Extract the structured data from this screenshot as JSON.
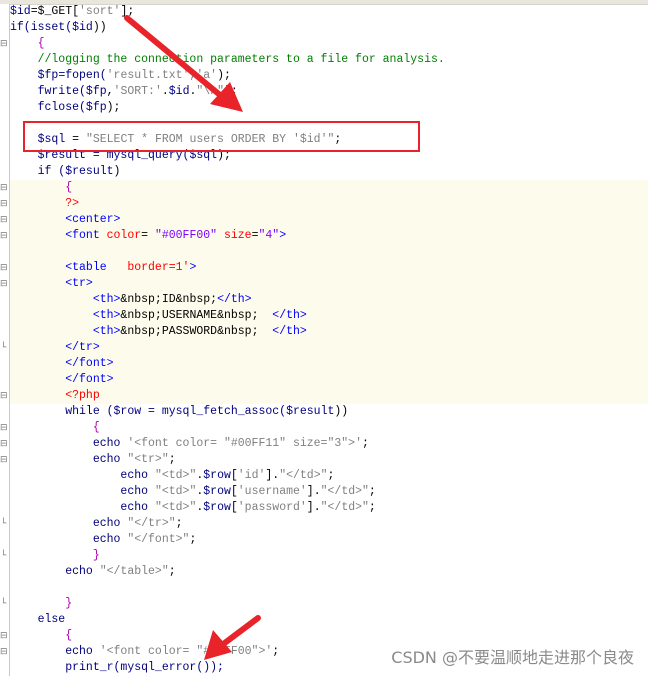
{
  "editor": {
    "lines": [
      [
        {
          "t": "$id",
          "c": "var"
        },
        {
          "t": "=$_GET[",
          "c": "plain"
        },
        {
          "t": "'sort'",
          "c": "str"
        },
        {
          "t": "];",
          "c": "plain"
        }
      ],
      [
        {
          "t": "if(isset(",
          "c": "kw"
        },
        {
          "t": "$id",
          "c": "var"
        },
        {
          "t": "))",
          "c": "plain"
        }
      ],
      [
        {
          "t": "    {",
          "c": "brace"
        }
      ],
      [
        {
          "t": "    //logging the connection parameters to a file for analysis.",
          "c": "com"
        }
      ],
      [
        {
          "t": "    ",
          "c": "plain"
        },
        {
          "t": "$fp",
          "c": "var"
        },
        {
          "t": "=fopen(",
          "c": "fn"
        },
        {
          "t": "'result.txt','a'",
          "c": "str"
        },
        {
          "t": ");",
          "c": "plain"
        }
      ],
      [
        {
          "t": "    fwrite(",
          "c": "fn"
        },
        {
          "t": "$fp",
          "c": "var"
        },
        {
          "t": ",",
          "c": "plain"
        },
        {
          "t": "'SORT:'",
          "c": "str"
        },
        {
          "t": ".",
          "c": "plain"
        },
        {
          "t": "$id",
          "c": "var"
        },
        {
          "t": ".",
          "c": "plain"
        },
        {
          "t": "\"\\n\"",
          "c": "str"
        },
        {
          "t": ");",
          "c": "plain"
        }
      ],
      [
        {
          "t": "    fclose(",
          "c": "fn"
        },
        {
          "t": "$fp",
          "c": "var"
        },
        {
          "t": ");",
          "c": "plain"
        }
      ],
      [
        {
          "t": "",
          "c": "plain"
        }
      ],
      [
        {
          "t": "    ",
          "c": "plain"
        },
        {
          "t": "$sql",
          "c": "var"
        },
        {
          "t": " = ",
          "c": "plain"
        },
        {
          "t": "\"SELECT * FROM users ORDER BY '$id'\"",
          "c": "str"
        },
        {
          "t": ";",
          "c": "plain"
        }
      ],
      [
        {
          "t": "    ",
          "c": "plain"
        },
        {
          "t": "$result",
          "c": "var"
        },
        {
          "t": " = mysql_query(",
          "c": "fn"
        },
        {
          "t": "$sql",
          "c": "var"
        },
        {
          "t": ");",
          "c": "plain"
        }
      ],
      [
        {
          "t": "    if (",
          "c": "kw"
        },
        {
          "t": "$result",
          "c": "var"
        },
        {
          "t": ")",
          "c": "plain"
        }
      ],
      [
        {
          "t": "        {",
          "c": "brace"
        }
      ],
      [
        {
          "t": "        ?>",
          "c": "php"
        }
      ],
      [
        {
          "t": "        <center>",
          "c": "tag"
        }
      ],
      [
        {
          "t": "        <font ",
          "c": "tag"
        },
        {
          "t": "color",
          "c": "attr"
        },
        {
          "t": "= ",
          "c": "plain"
        },
        {
          "t": "\"#00FF00\"",
          "c": "attrval"
        },
        {
          "t": " size",
          "c": "attr"
        },
        {
          "t": "=",
          "c": "plain"
        },
        {
          "t": "\"4\"",
          "c": "attrval"
        },
        {
          "t": ">",
          "c": "tag"
        }
      ],
      [
        {
          "t": "",
          "c": "plain"
        }
      ],
      [
        {
          "t": "        <table   ",
          "c": "tag"
        },
        {
          "t": "border",
          "c": "attr"
        },
        {
          "t": "=1'",
          "c": "attr"
        },
        {
          "t": ">",
          "c": "tag"
        }
      ],
      [
        {
          "t": "        <tr>",
          "c": "tag"
        }
      ],
      [
        {
          "t": "            <th>",
          "c": "tag"
        },
        {
          "t": "&nbsp;",
          "c": "ent"
        },
        {
          "t": "ID",
          "c": "plain"
        },
        {
          "t": "&nbsp;",
          "c": "ent"
        },
        {
          "t": "</th>",
          "c": "tag"
        }
      ],
      [
        {
          "t": "            <th>",
          "c": "tag"
        },
        {
          "t": "&nbsp;",
          "c": "ent"
        },
        {
          "t": "USERNAME",
          "c": "plain"
        },
        {
          "t": "&nbsp;",
          "c": "ent"
        },
        {
          "t": "  </th>",
          "c": "tag"
        }
      ],
      [
        {
          "t": "            <th>",
          "c": "tag"
        },
        {
          "t": "&nbsp;",
          "c": "ent"
        },
        {
          "t": "PASSWORD",
          "c": "plain"
        },
        {
          "t": "&nbsp;",
          "c": "ent"
        },
        {
          "t": "  </th>",
          "c": "tag"
        }
      ],
      [
        {
          "t": "        </tr>",
          "c": "tag"
        }
      ],
      [
        {
          "t": "        </font>",
          "c": "tag"
        }
      ],
      [
        {
          "t": "        </font>",
          "c": "tag"
        }
      ],
      [
        {
          "t": "        <?php",
          "c": "php"
        }
      ],
      [
        {
          "t": "        while (",
          "c": "kw"
        },
        {
          "t": "$row",
          "c": "var"
        },
        {
          "t": " = mysql_fetch_assoc(",
          "c": "fn"
        },
        {
          "t": "$result",
          "c": "var"
        },
        {
          "t": "))",
          "c": "plain"
        }
      ],
      [
        {
          "t": "            {",
          "c": "brace"
        }
      ],
      [
        {
          "t": "            echo ",
          "c": "kw"
        },
        {
          "t": "'<font color= \"#00FF11\" size=\"3\">'",
          "c": "str"
        },
        {
          "t": ";",
          "c": "plain"
        }
      ],
      [
        {
          "t": "            echo ",
          "c": "kw"
        },
        {
          "t": "\"<tr>\"",
          "c": "str"
        },
        {
          "t": ";",
          "c": "plain"
        }
      ],
      [
        {
          "t": "                echo ",
          "c": "kw"
        },
        {
          "t": "\"<td>\"",
          "c": "str"
        },
        {
          "t": ".",
          "c": "plain"
        },
        {
          "t": "$row",
          "c": "var"
        },
        {
          "t": "[",
          "c": "plain"
        },
        {
          "t": "'id'",
          "c": "str"
        },
        {
          "t": "].",
          "c": "plain"
        },
        {
          "t": "\"</td>\"",
          "c": "str"
        },
        {
          "t": ";",
          "c": "plain"
        }
      ],
      [
        {
          "t": "                echo ",
          "c": "kw"
        },
        {
          "t": "\"<td>\"",
          "c": "str"
        },
        {
          "t": ".",
          "c": "plain"
        },
        {
          "t": "$row",
          "c": "var"
        },
        {
          "t": "[",
          "c": "plain"
        },
        {
          "t": "'username'",
          "c": "str"
        },
        {
          "t": "].",
          "c": "plain"
        },
        {
          "t": "\"</td>\"",
          "c": "str"
        },
        {
          "t": ";",
          "c": "plain"
        }
      ],
      [
        {
          "t": "                echo ",
          "c": "kw"
        },
        {
          "t": "\"<td>\"",
          "c": "str"
        },
        {
          "t": ".",
          "c": "plain"
        },
        {
          "t": "$row",
          "c": "var"
        },
        {
          "t": "[",
          "c": "plain"
        },
        {
          "t": "'password'",
          "c": "str"
        },
        {
          "t": "].",
          "c": "plain"
        },
        {
          "t": "\"</td>\"",
          "c": "str"
        },
        {
          "t": ";",
          "c": "plain"
        }
      ],
      [
        {
          "t": "            echo ",
          "c": "kw"
        },
        {
          "t": "\"</tr>\"",
          "c": "str"
        },
        {
          "t": ";",
          "c": "plain"
        }
      ],
      [
        {
          "t": "            echo ",
          "c": "kw"
        },
        {
          "t": "\"</font>\"",
          "c": "str"
        },
        {
          "t": ";",
          "c": "plain"
        }
      ],
      [
        {
          "t": "            }",
          "c": "brace"
        }
      ],
      [
        {
          "t": "        echo ",
          "c": "kw"
        },
        {
          "t": "\"</table>\"",
          "c": "str"
        },
        {
          "t": ";",
          "c": "plain"
        }
      ],
      [
        {
          "t": "",
          "c": "plain"
        }
      ],
      [
        {
          "t": "        }",
          "c": "brace"
        }
      ],
      [
        {
          "t": "    else",
          "c": "kw"
        }
      ],
      [
        {
          "t": "        {",
          "c": "brace"
        }
      ],
      [
        {
          "t": "        echo ",
          "c": "kw"
        },
        {
          "t": "'<font color= \"#FFFF00\">'",
          "c": "str"
        },
        {
          "t": ";",
          "c": "plain"
        }
      ],
      [
        {
          "t": "        print_r(mysql_error());",
          "c": "fn"
        }
      ]
    ],
    "highlighted_lines": [
      11,
      12,
      13,
      14,
      15,
      16,
      17,
      18,
      19,
      20,
      21,
      22,
      23,
      24
    ]
  },
  "watermark": "CSDN @不要温顺地走进那个良夜",
  "colors": {
    "annotation_red": "#e8242a",
    "variable": "#000080",
    "string": "#808080",
    "comment": "#008000",
    "html_tag": "#0000ff"
  }
}
